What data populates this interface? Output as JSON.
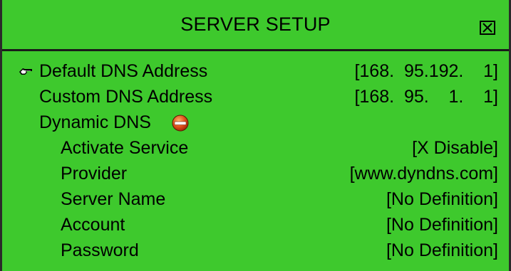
{
  "window": {
    "title": "SERVER SETUP",
    "close_icon": "close-icon",
    "accent_color": "#3ec92d"
  },
  "rows": {
    "default_dns": {
      "label": "Default DNS Address",
      "value": "[168.  95.192.    1]",
      "selected": true,
      "cursor_icon": "pointing-hand-icon"
    },
    "custom_dns": {
      "label": "Custom DNS Address",
      "value": "[168.  95.    1.    1]"
    },
    "dynamic_dns": {
      "label": "Dynamic DNS",
      "toggle_icon": "collapse-minus-icon"
    },
    "activate_service": {
      "label": "Activate Service",
      "value": "[X Disable]"
    },
    "provider": {
      "label": "Provider",
      "value": "[www.dyndns.com]"
    },
    "server_name": {
      "label": "Server Name",
      "value": "[No Definition]"
    },
    "account": {
      "label": "Account",
      "value": "[No Definition]"
    },
    "password": {
      "label": "Password",
      "value": "[No Definition]"
    }
  }
}
